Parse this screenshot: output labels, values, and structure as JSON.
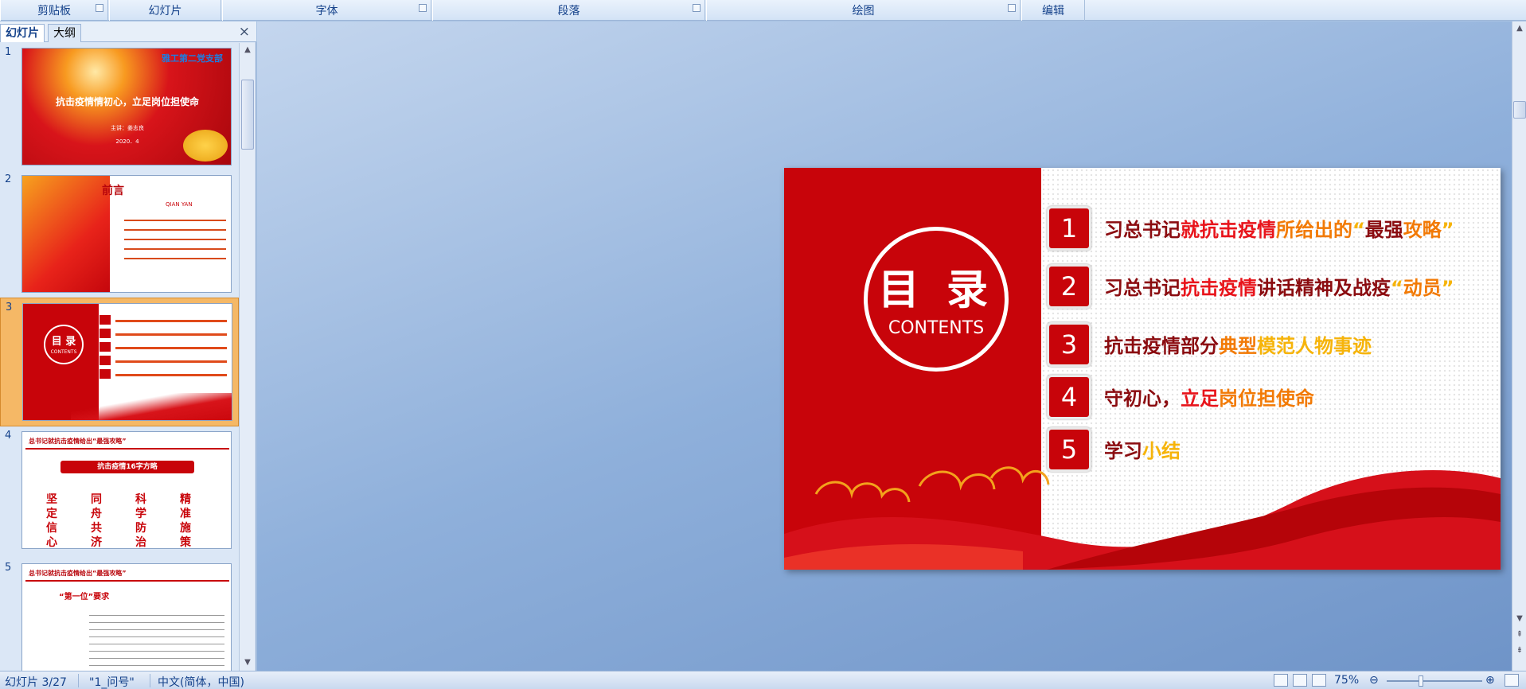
{
  "ribbon": {
    "groups": [
      "剪贴板",
      "幻灯片",
      "字体",
      "段落",
      "绘图",
      "编辑"
    ]
  },
  "left_panel": {
    "tabs": [
      "幻灯片",
      "大纲"
    ],
    "close_icon": "×",
    "thumbnails": [
      {
        "num": "1",
        "title": "抗击疫情情初心，立足岗位担使命",
        "org": "雅工第二党支部",
        "presenter": "主讲：姜志良",
        "date": "2020．4"
      },
      {
        "num": "2",
        "title": "前言",
        "subtitle": "QIAN YAN"
      },
      {
        "num": "3",
        "title": "目 录",
        "subtitle": "CONTENTS"
      },
      {
        "num": "4",
        "title": "总书记就抗击疫情给出“最强攻略”",
        "banner": "抗击疫情16字方略",
        "words": [
          "坚定信心",
          "同舟共济",
          "科学防治",
          "精准施策"
        ]
      },
      {
        "num": "5",
        "title": "总书记就抗击疫情给出“最强攻略”",
        "subtitle": "“第一位”要求"
      }
    ]
  },
  "slide": {
    "circle_title": "目 录",
    "circle_subtitle": "CONTENTS",
    "items": [
      {
        "num": "1",
        "parts": [
          [
            "习总书记",
            "t-dark"
          ],
          [
            "就",
            "t-red"
          ],
          [
            "抗击疫情",
            "t-red"
          ],
          [
            "所给出的",
            "t-orange"
          ],
          [
            "“",
            "t-yellow"
          ],
          [
            "最强",
            "t-dark"
          ],
          [
            "攻略",
            "t-orange"
          ],
          [
            "”",
            "t-yellow"
          ]
        ]
      },
      {
        "num": "2",
        "parts": [
          [
            "习总书记",
            "t-dark"
          ],
          [
            "抗击",
            "t-red"
          ],
          [
            "疫情",
            "t-red"
          ],
          [
            "讲话精神及战疫",
            "t-dark"
          ],
          [
            "“",
            "t-yellow"
          ],
          [
            "动员",
            "t-orange"
          ],
          [
            "”",
            "t-yellow"
          ]
        ]
      },
      {
        "num": "3",
        "parts": [
          [
            "抗击疫情部分",
            "t-dark"
          ],
          [
            "典型",
            "t-orange"
          ],
          [
            "模范人物事迹",
            "t-yellow"
          ]
        ]
      },
      {
        "num": "4",
        "parts": [
          [
            "守初心，",
            "t-dark"
          ],
          [
            "立足",
            "t-red"
          ],
          [
            "岗位担使命",
            "t-orange"
          ]
        ]
      },
      {
        "num": "5",
        "parts": [
          [
            "学习",
            "t-dark"
          ],
          [
            "小结",
            "t-yellow"
          ]
        ]
      }
    ]
  },
  "status": {
    "slide_info": "幻灯片 3/27",
    "theme": "\"1_问号\"",
    "language": "中文(简体，中国)",
    "zoom": "75%"
  },
  "colors": {
    "slide_red": "#c8040a",
    "ribbon_text": "#15428b"
  }
}
